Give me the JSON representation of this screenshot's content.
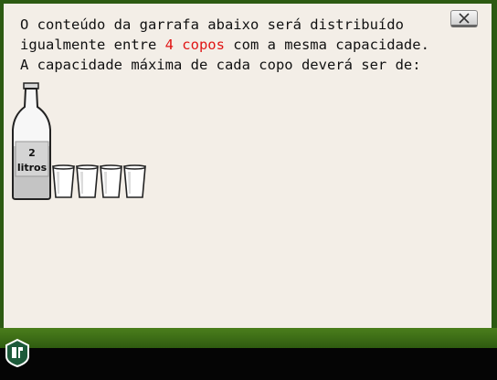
{
  "question": {
    "line1": "O conteúdo da garrafa abaixo será distribuído",
    "line2_before": "igualmente entre ",
    "line2_highlight": "4 copos",
    "line2_after": " com a mesma capacidade.",
    "line3": "A capacidade máxima de cada copo deverá ser de:"
  },
  "bottle": {
    "label_line1": "2",
    "label_line2": "litros"
  },
  "glasses_count": 4,
  "close_button": {
    "icon": "close-icon"
  },
  "logo": {
    "icon": "logo-icon"
  },
  "colors": {
    "highlight": "#e01414",
    "panel": "#f3eee7",
    "grass": "#4b7e1c",
    "footer": "#050505"
  }
}
